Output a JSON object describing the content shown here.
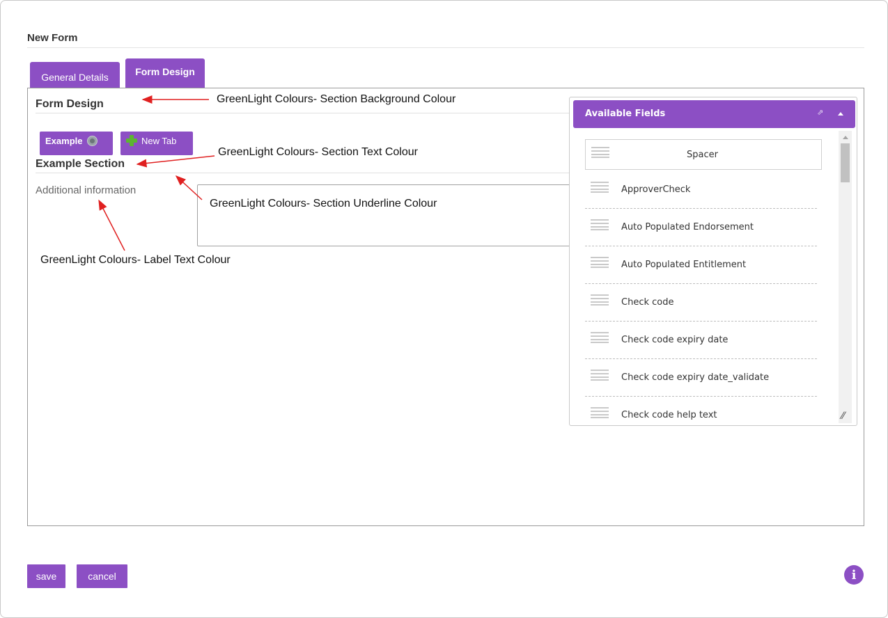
{
  "page": {
    "title": "New Form"
  },
  "tabs": [
    {
      "label": "General Details"
    },
    {
      "label": "Form Design",
      "active": true
    }
  ],
  "design": {
    "section_title": "Form Design",
    "mini_tabs": {
      "example": "Example",
      "new_tab": "New Tab"
    },
    "example_section": "Example Section",
    "field_label": "Additional information"
  },
  "annotations": {
    "section_background": "GreenLight Colours- Section Background Colour",
    "section_text": "GreenLight Colours- Section Text Colour",
    "section_underline": "GreenLight Colours- Section Underline Colour",
    "label_text": "GreenLight Colours- Label Text Colour"
  },
  "available_fields": {
    "title": "Available Fields",
    "items": [
      "Spacer",
      "ApproverCheck",
      "Auto Populated Endorsement",
      "Auto Populated Entitlement",
      "Check code",
      "Check code expiry date",
      "Check code expiry date_validate",
      "Check code help text"
    ]
  },
  "actions": {
    "save": "save",
    "cancel": "cancel"
  },
  "icons": {
    "gear": "gear-icon",
    "plus": "plus-icon",
    "drag": "drag-handle-icon",
    "popout": "popout-icon",
    "collapse": "collapse-icon",
    "info": "info-icon",
    "resize": "resize-icon"
  },
  "colors": {
    "accent": "#8c4fc4",
    "annotation_arrow": "#e02020",
    "plus_green": "#5cb531"
  }
}
